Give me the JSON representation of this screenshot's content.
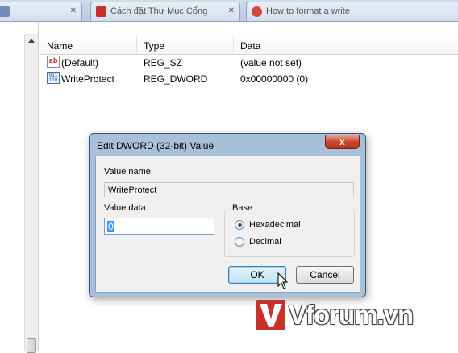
{
  "browser_tabs": [
    {
      "label": "",
      "favicon_color": "#6f8fb8"
    },
    {
      "label": "Cách đặt Thư Mục Cổng",
      "favicon_color": "#c8302a"
    },
    {
      "label": "How to format a write",
      "favicon_color": "#d04a3c"
    }
  ],
  "list": {
    "columns": [
      "Name",
      "Type",
      "Data"
    ],
    "rows": [
      {
        "icon": "string-value-icon",
        "name": "(Default)",
        "type": "REG_SZ",
        "data": "(value not set)"
      },
      {
        "icon": "dword-value-icon",
        "name": "WriteProtect",
        "type": "REG_DWORD",
        "data": "0x00000000 (0)"
      }
    ]
  },
  "dialog": {
    "title": "Edit DWORD (32-bit) Value",
    "close_label": "x",
    "value_name_label": "Value name:",
    "value_name": "WriteProtect",
    "value_data_label": "Value data:",
    "value_data": "0",
    "base_label": "Base",
    "base_options": [
      "Hexadecimal",
      "Decimal"
    ],
    "base_selected": "Hexadecimal",
    "ok_label": "OK",
    "cancel_label": "Cancel"
  },
  "watermark": {
    "text": "Vforum.vn",
    "logo_letter": "V",
    "logo_color": "#c8302a"
  },
  "colors": {
    "dialog_frame": "#a9c0d9",
    "close_button": "#c7472d",
    "selection": "#3399ff"
  }
}
